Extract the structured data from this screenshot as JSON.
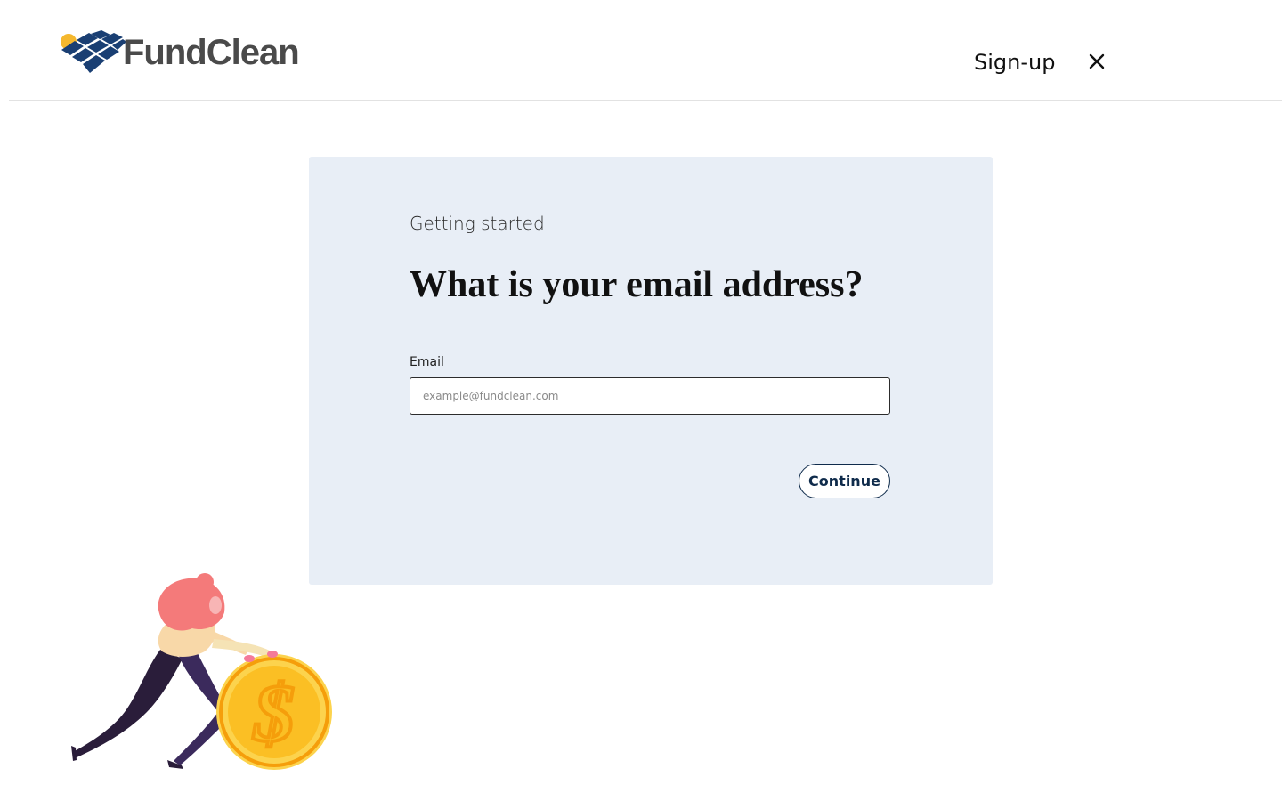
{
  "header": {
    "brand_name": "FundClean",
    "page_label": "Sign-up",
    "close_icon": "close-icon"
  },
  "card": {
    "eyebrow": "Getting started",
    "question": "What is your email address?",
    "email": {
      "label": "Email",
      "placeholder": "example@fundclean.com",
      "value": ""
    },
    "continue_label": "Continue"
  },
  "colors": {
    "brand_navy": "#0f2b4b",
    "logo_blue": "#1a3f73",
    "logo_sun": "#f5b82e",
    "card_background": "#e8eef6",
    "coin": "#fbbf24",
    "coin_symbol": "#f59e0b"
  }
}
